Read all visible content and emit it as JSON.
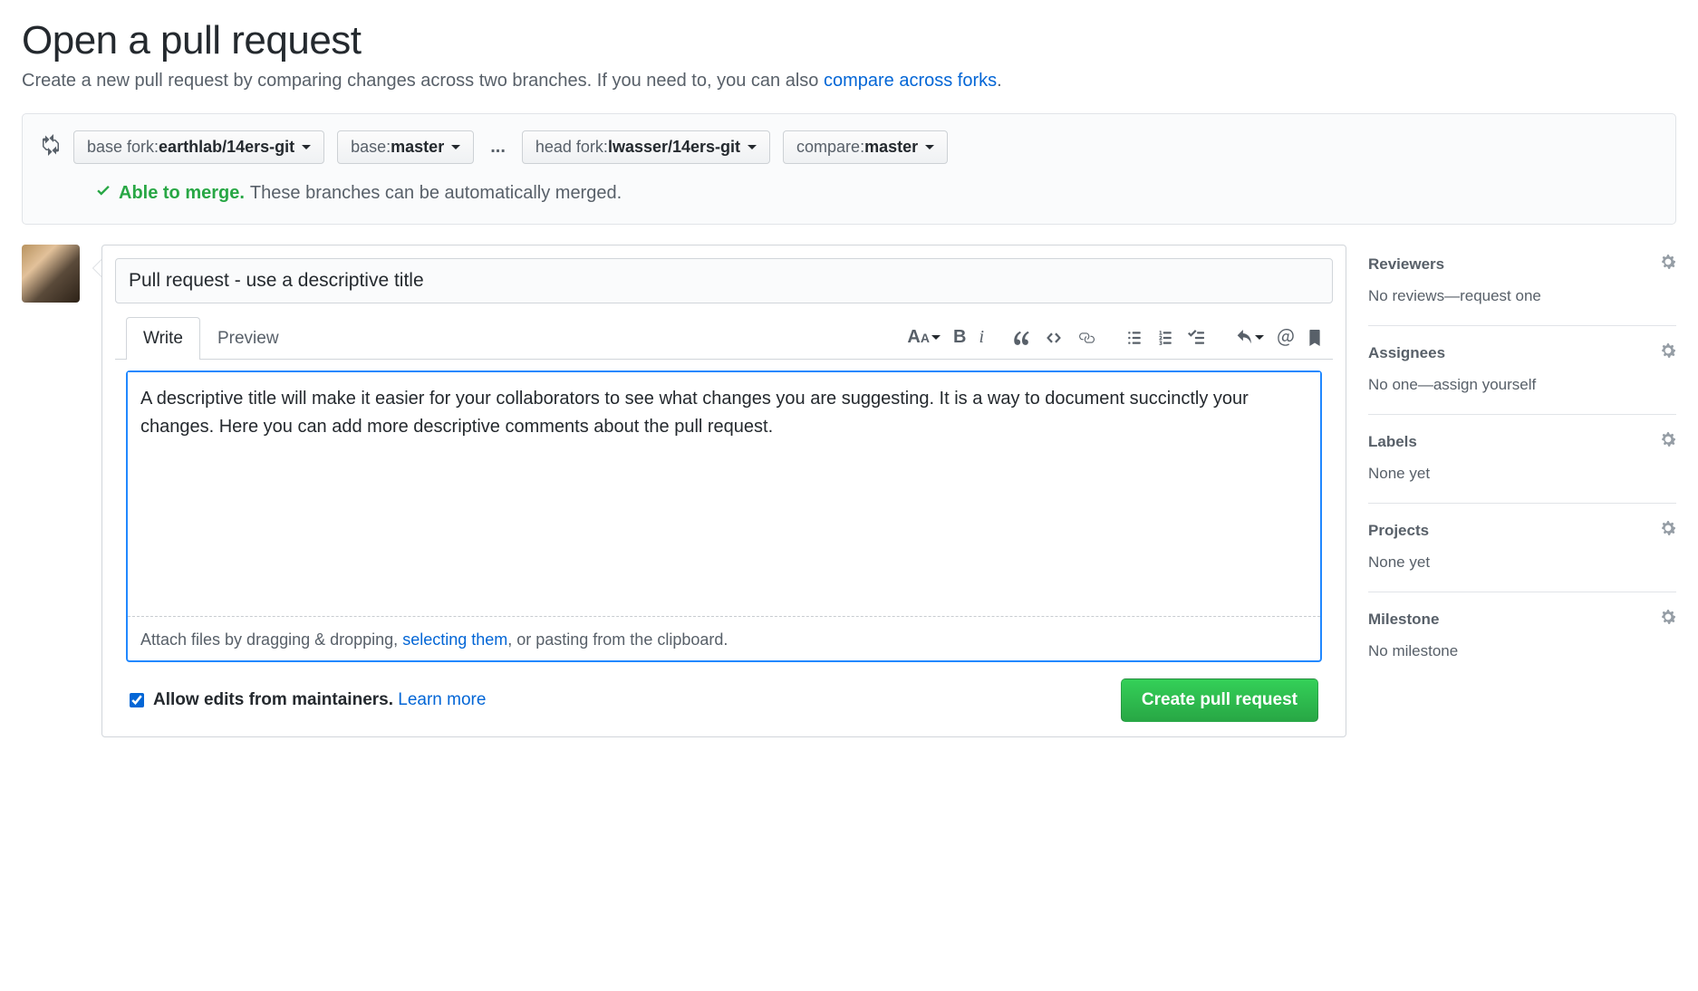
{
  "page": {
    "title": "Open a pull request",
    "subtitle_prefix": "Create a new pull request by comparing changes across two branches. If you need to, you can also ",
    "subtitle_link": "compare across forks",
    "subtitle_suffix": "."
  },
  "compare": {
    "base_fork_label": "base fork: ",
    "base_fork_value": "earthlab/14ers-git",
    "base_label": "base: ",
    "base_value": "master",
    "head_fork_label": "head fork: ",
    "head_fork_value": "lwasser/14ers-git",
    "compare_label": "compare: ",
    "compare_value": "master"
  },
  "merge": {
    "able": "Able to merge.",
    "info": "These branches can be automatically merged."
  },
  "form": {
    "title_value": "Pull request - use a descriptive title",
    "tabs": {
      "write": "Write",
      "preview": "Preview"
    },
    "body_value": "A descriptive title will make it easier for your collaborators to see what changes you are suggesting. It is a way to document succinctly your changes. Here you can add more descriptive comments about the pull request.",
    "attach_prefix": "Attach files by dragging & dropping, ",
    "attach_link": "selecting them",
    "attach_suffix": ", or pasting from the clipboard.",
    "allow_edits": "Allow edits from maintainers.",
    "learn_more": "Learn more",
    "create_button": "Create pull request"
  },
  "sidebar": {
    "reviewers": {
      "title": "Reviewers",
      "body": "No reviews—request one"
    },
    "assignees": {
      "title": "Assignees",
      "body_prefix": "No one—",
      "body_link": "assign yourself"
    },
    "labels": {
      "title": "Labels",
      "body": "None yet"
    },
    "projects": {
      "title": "Projects",
      "body": "None yet"
    },
    "milestone": {
      "title": "Milestone",
      "body": "No milestone"
    }
  }
}
